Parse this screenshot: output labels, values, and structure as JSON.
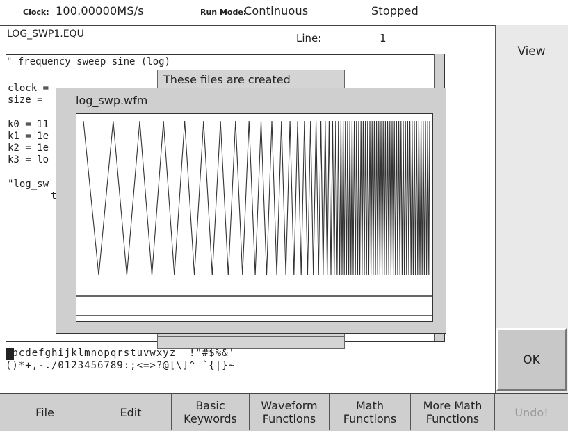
{
  "status": {
    "clock_label": "Clock:",
    "clock_value": "100.00000MS/s",
    "runmode_label": "Run Mode:",
    "runmode_value": "Continuous",
    "state": "Stopped"
  },
  "editor": {
    "file_name": "LOG_SWP1.EQU",
    "line_label": "Line:",
    "line_value": "1",
    "lines": {
      "l1": "\" frequency sweep sine (log)",
      "l2": "clock =",
      "l3": "size =",
      "l4": "k0 = 11",
      "l5": "k1 = 1e",
      "l6": "k2 = 1e",
      "l7": "k3 = lo",
      "l8": "\"log_sw",
      "l9": "t"
    }
  },
  "back_dialog": {
    "title": "These files are created"
  },
  "waveform_dialog": {
    "title": "log_swp.wfm"
  },
  "char_palette": {
    "row1": "abcdefghijklmnopqrstuvwxyz  !\"#$%&'",
    "row2": "()*+,-./0123456789:;<=>?@[\\]^_`{|}~"
  },
  "side_buttons": {
    "view": "View",
    "ok": "OK"
  },
  "menu": {
    "file": "File",
    "edit": "Edit",
    "basic_1": "Basic",
    "basic_2": "Keywords",
    "waveform_1": "Waveform",
    "waveform_2": "Functions",
    "math_1": "Math",
    "math_2": "Functions",
    "moremath_1": "More Math",
    "moremath_2": "Functions",
    "undo": "Undo!"
  }
}
